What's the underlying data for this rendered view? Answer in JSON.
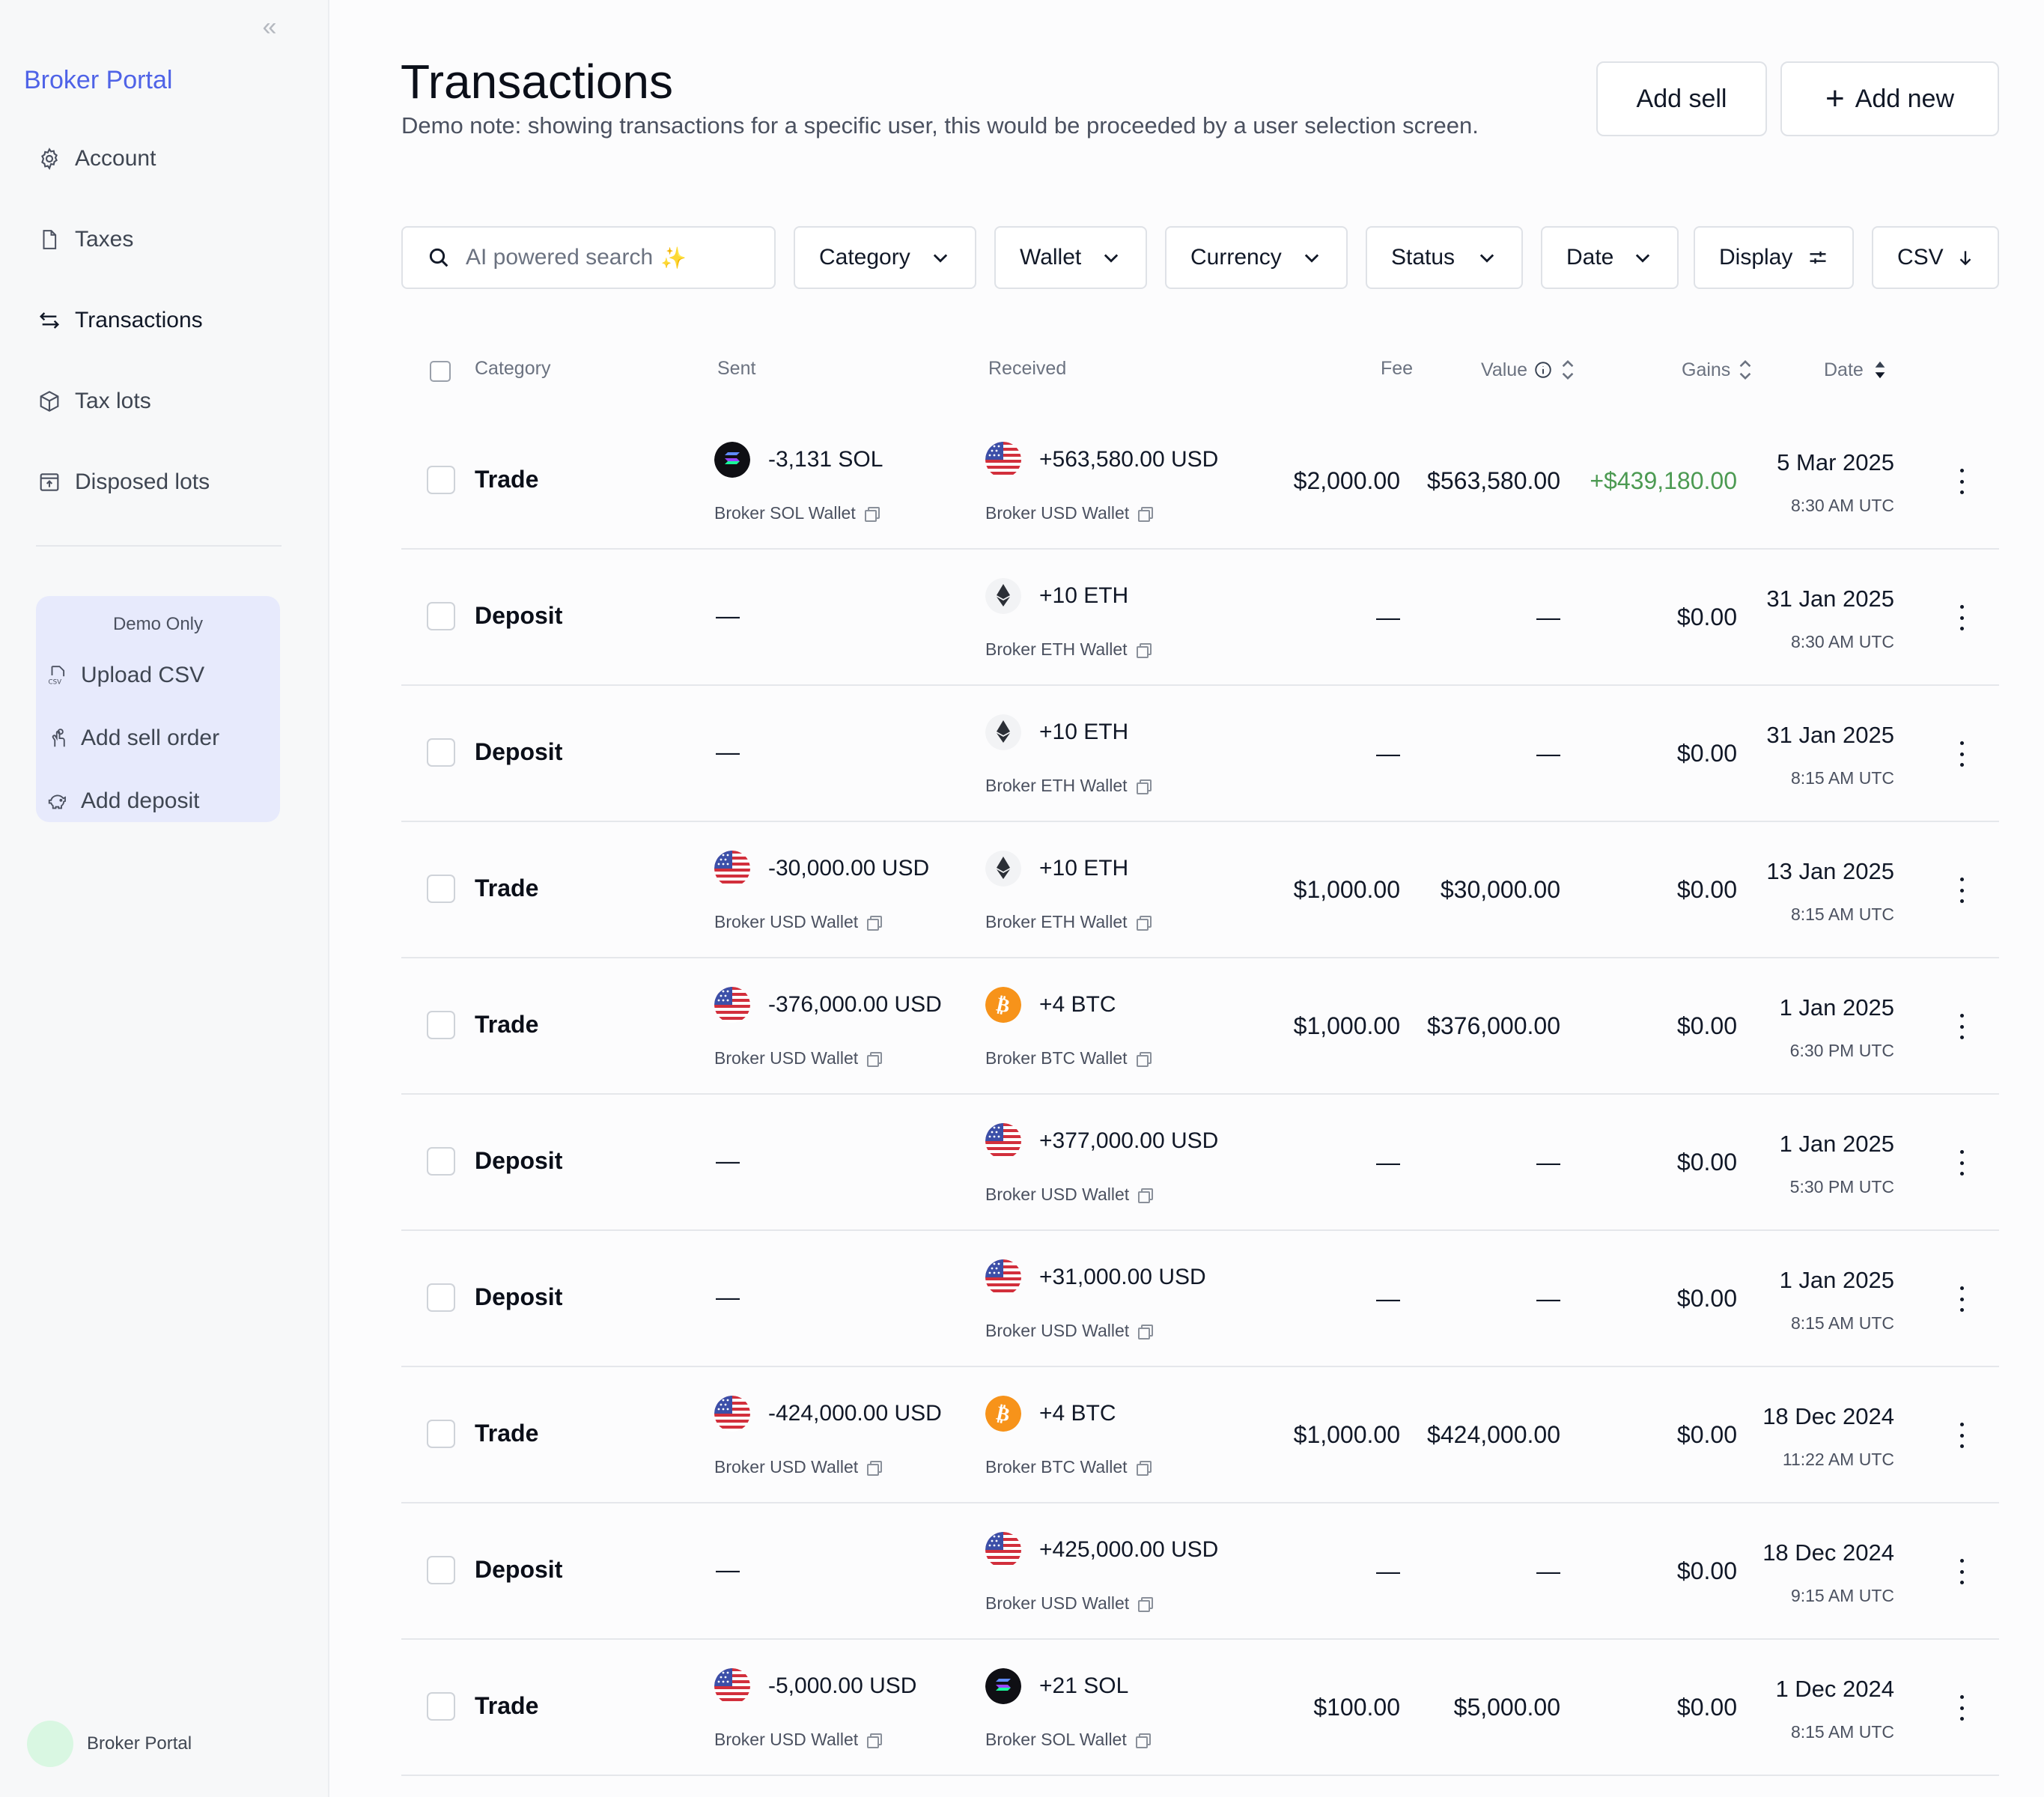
{
  "sidebar": {
    "brand": "Broker Portal",
    "nav": [
      {
        "label": "Account",
        "icon": "gear-icon"
      },
      {
        "label": "Taxes",
        "icon": "document-icon"
      },
      {
        "label": "Transactions",
        "icon": "arrows-swap-icon",
        "active": true
      },
      {
        "label": "Tax lots",
        "icon": "box-icon"
      },
      {
        "label": "Disposed lots",
        "icon": "archive-icon"
      }
    ],
    "demo": {
      "title": "Demo Only",
      "items": [
        {
          "label": "Upload CSV",
          "icon": "csv-file-icon"
        },
        {
          "label": "Add sell order",
          "icon": "hand-coin-icon"
        },
        {
          "label": "Add deposit",
          "icon": "piggy-bank-icon"
        }
      ]
    },
    "user_name": "Broker Portal"
  },
  "header": {
    "title": "Transactions",
    "subtitle": "Demo note: showing transactions for a specific user, this would be proceeded by a user selection screen.",
    "add_sell": "Add sell",
    "add_new": "Add new"
  },
  "filters": {
    "search_placeholder": "AI powered search",
    "category": "Category",
    "wallet": "Wallet",
    "currency": "Currency",
    "status": "Status",
    "date": "Date",
    "display": "Display",
    "csv": "CSV"
  },
  "table": {
    "columns": {
      "category": "Category",
      "sent": "Sent",
      "received": "Received",
      "fee": "Fee",
      "value": "Value",
      "gains": "Gains",
      "date": "Date"
    },
    "rows": [
      {
        "category": "Trade",
        "sent_amount": "-3,131 SOL",
        "sent_wallet": "Broker SOL Wallet",
        "sent_asset": "sol",
        "recv_amount": "+563,580.00 USD",
        "recv_wallet": "Broker USD Wallet",
        "recv_asset": "usd",
        "fee": "$2,000.00",
        "value": "$563,580.00",
        "gains": "+$439,180.00",
        "gains_positive": true,
        "date": "5 Mar 2025",
        "time": "8:30 AM UTC"
      },
      {
        "category": "Deposit",
        "sent_amount": "—",
        "sent_wallet": "",
        "sent_asset": "",
        "recv_amount": "+10 ETH",
        "recv_wallet": "Broker ETH Wallet",
        "recv_asset": "eth",
        "fee": "—",
        "value": "—",
        "gains": "$0.00",
        "gains_positive": false,
        "date": "31 Jan 2025",
        "time": "8:30 AM UTC"
      },
      {
        "category": "Deposit",
        "sent_amount": "—",
        "sent_wallet": "",
        "sent_asset": "",
        "recv_amount": "+10 ETH",
        "recv_wallet": "Broker ETH Wallet",
        "recv_asset": "eth",
        "fee": "—",
        "value": "—",
        "gains": "$0.00",
        "gains_positive": false,
        "date": "31 Jan 2025",
        "time": "8:15 AM UTC"
      },
      {
        "category": "Trade",
        "sent_amount": "-30,000.00 USD",
        "sent_wallet": "Broker USD Wallet",
        "sent_asset": "usd",
        "recv_amount": "+10 ETH",
        "recv_wallet": "Broker ETH Wallet",
        "recv_asset": "eth",
        "fee": "$1,000.00",
        "value": "$30,000.00",
        "gains": "$0.00",
        "gains_positive": false,
        "date": "13 Jan 2025",
        "time": "8:15 AM UTC"
      },
      {
        "category": "Trade",
        "sent_amount": "-376,000.00 USD",
        "sent_wallet": "Broker USD Wallet",
        "sent_asset": "usd",
        "recv_amount": "+4 BTC",
        "recv_wallet": "Broker BTC Wallet",
        "recv_asset": "btc",
        "fee": "$1,000.00",
        "value": "$376,000.00",
        "gains": "$0.00",
        "gains_positive": false,
        "date": "1 Jan 2025",
        "time": "6:30 PM UTC"
      },
      {
        "category": "Deposit",
        "sent_amount": "—",
        "sent_wallet": "",
        "sent_asset": "",
        "recv_amount": "+377,000.00 USD",
        "recv_wallet": "Broker USD Wallet",
        "recv_asset": "usd",
        "fee": "—",
        "value": "—",
        "gains": "$0.00",
        "gains_positive": false,
        "date": "1 Jan 2025",
        "time": "5:30 PM UTC"
      },
      {
        "category": "Deposit",
        "sent_amount": "—",
        "sent_wallet": "",
        "sent_asset": "",
        "recv_amount": "+31,000.00 USD",
        "recv_wallet": "Broker USD Wallet",
        "recv_asset": "usd",
        "fee": "—",
        "value": "—",
        "gains": "$0.00",
        "gains_positive": false,
        "date": "1 Jan 2025",
        "time": "8:15 AM UTC"
      },
      {
        "category": "Trade",
        "sent_amount": "-424,000.00 USD",
        "sent_wallet": "Broker USD Wallet",
        "sent_asset": "usd",
        "recv_amount": "+4 BTC",
        "recv_wallet": "Broker BTC Wallet",
        "recv_asset": "btc",
        "fee": "$1,000.00",
        "value": "$424,000.00",
        "gains": "$0.00",
        "gains_positive": false,
        "date": "18 Dec 2024",
        "time": "11:22 AM UTC"
      },
      {
        "category": "Deposit",
        "sent_amount": "—",
        "sent_wallet": "",
        "sent_asset": "",
        "recv_amount": "+425,000.00 USD",
        "recv_wallet": "Broker USD Wallet",
        "recv_asset": "usd",
        "fee": "—",
        "value": "—",
        "gains": "$0.00",
        "gains_positive": false,
        "date": "18 Dec 2024",
        "time": "9:15 AM UTC"
      },
      {
        "category": "Trade",
        "sent_amount": "-5,000.00 USD",
        "sent_wallet": "Broker USD Wallet",
        "sent_asset": "usd",
        "recv_amount": "+21 SOL",
        "recv_wallet": "Broker SOL Wallet",
        "recv_asset": "sol",
        "fee": "$100.00",
        "value": "$5,000.00",
        "gains": "$0.00",
        "gains_positive": false,
        "date": "1 Dec 2024",
        "time": "8:15 AM UTC"
      }
    ]
  },
  "colors": {
    "brand": "#4f63e7",
    "positive": "#4c9a52",
    "btc": "#f7931a",
    "demo_bg": "#e7eafc"
  }
}
